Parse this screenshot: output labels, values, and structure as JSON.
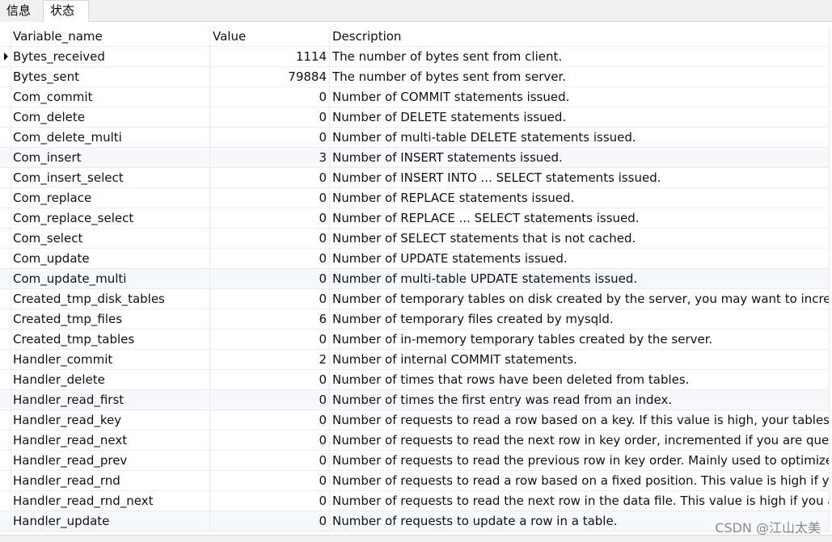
{
  "tabs": {
    "info": "信息",
    "status": "状态"
  },
  "columns": {
    "name": "Variable_name",
    "value": "Value",
    "description": "Description"
  },
  "rows": [
    {
      "name": "Bytes_received",
      "value": "1114",
      "description": "The number of bytes sent from client."
    },
    {
      "name": "Bytes_sent",
      "value": "79884",
      "description": "The number of bytes sent from server."
    },
    {
      "name": "Com_commit",
      "value": "0",
      "description": "Number of COMMIT statements issued."
    },
    {
      "name": "Com_delete",
      "value": "0",
      "description": "Number of DELETE statements issued."
    },
    {
      "name": "Com_delete_multi",
      "value": "0",
      "description": "Number of multi-table DELETE statements issued."
    },
    {
      "name": "Com_insert",
      "value": "3",
      "description": "Number of INSERT statements issued."
    },
    {
      "name": "Com_insert_select",
      "value": "0",
      "description": "Number of INSERT INTO ... SELECT statements issued."
    },
    {
      "name": "Com_replace",
      "value": "0",
      "description": "Number of REPLACE statements issued."
    },
    {
      "name": "Com_replace_select",
      "value": "0",
      "description": "Number of REPLACE ... SELECT statements issued."
    },
    {
      "name": "Com_select",
      "value": "0",
      "description": "Number of SELECT statements that is not cached."
    },
    {
      "name": "Com_update",
      "value": "0",
      "description": "Number of UPDATE statements issued."
    },
    {
      "name": "Com_update_multi",
      "value": "0",
      "description": "Number of multi-table UPDATE statements issued."
    },
    {
      "name": "Created_tmp_disk_tables",
      "value": "0",
      "description": "Number of temporary tables on disk created by the server, you may want to increase"
    },
    {
      "name": "Created_tmp_files",
      "value": "6",
      "description": "Number of temporary files created by mysqld."
    },
    {
      "name": "Created_tmp_tables",
      "value": "0",
      "description": "Number of in-memory temporary tables created by the server."
    },
    {
      "name": "Handler_commit",
      "value": "2",
      "description": "Number of internal COMMIT statements."
    },
    {
      "name": "Handler_delete",
      "value": "0",
      "description": "Number of times that rows have been deleted from tables."
    },
    {
      "name": "Handler_read_first",
      "value": "0",
      "description": "Number of times the first entry was read from an index."
    },
    {
      "name": "Handler_read_key",
      "value": "0",
      "description": "Number of requests to read a row based on a key. If this value is high, your tables ma"
    },
    {
      "name": "Handler_read_next",
      "value": "0",
      "description": "Number of requests to read the next row in key order, incremented if you are queryi"
    },
    {
      "name": "Handler_read_prev",
      "value": "0",
      "description": "Number of requests to read the previous row in key order. Mainly used to optimize O"
    },
    {
      "name": "Handler_read_rnd",
      "value": "0",
      "description": "Number of requests to read a row based on a fixed position. This value is high if you a"
    },
    {
      "name": "Handler_read_rnd_next",
      "value": "0",
      "description": "Number of requests to read the next row in the data file. This value is high if you are c"
    },
    {
      "name": "Handler_update",
      "value": "0",
      "description": "Number of requests to update a row in a table."
    }
  ],
  "watermark": "CSDN @江山太美"
}
